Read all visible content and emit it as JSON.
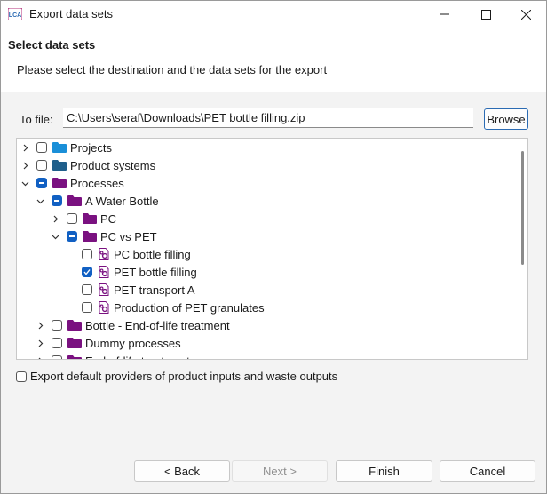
{
  "window": {
    "title": "Export data sets",
    "app_icon": "lca-app-icon"
  },
  "header": {
    "title": "Select data sets",
    "description": "Please select the destination and the data sets for the export"
  },
  "file": {
    "label": "To file:",
    "value": "C:\\Users\\seraf\\Downloads\\PET bottle filling.zip",
    "browse_label": "Browse"
  },
  "tree": [
    {
      "label": "Projects",
      "level": 0,
      "expanded": false,
      "check": "unchecked",
      "icon": "folder",
      "color": "#1a8fd8"
    },
    {
      "label": "Product systems",
      "level": 0,
      "expanded": false,
      "check": "unchecked",
      "icon": "folder",
      "color": "#1f5f8b"
    },
    {
      "label": "Processes",
      "level": 0,
      "expanded": true,
      "check": "partial",
      "icon": "folder",
      "color": "#7a1180"
    },
    {
      "label": "A Water Bottle",
      "level": 1,
      "expanded": true,
      "check": "partial",
      "icon": "folder",
      "color": "#7a1180"
    },
    {
      "label": "PC",
      "level": 2,
      "expanded": false,
      "check": "unchecked",
      "icon": "folder",
      "color": "#7a1180"
    },
    {
      "label": "PC vs PET",
      "level": 2,
      "expanded": true,
      "check": "partial",
      "icon": "folder",
      "color": "#7a1180"
    },
    {
      "label": "PC bottle filling",
      "level": 3,
      "leaf": true,
      "check": "unchecked",
      "icon": "process"
    },
    {
      "label": "PET bottle filling",
      "level": 3,
      "leaf": true,
      "check": "checked",
      "icon": "process"
    },
    {
      "label": "PET transport A",
      "level": 3,
      "leaf": true,
      "check": "unchecked",
      "icon": "process"
    },
    {
      "label": "Production of PET granulates",
      "level": 3,
      "leaf": true,
      "check": "unchecked",
      "icon": "process"
    },
    {
      "label": "Bottle - End-of-life treatment",
      "level": 1,
      "expanded": false,
      "check": "unchecked",
      "icon": "folder",
      "color": "#7a1180"
    },
    {
      "label": "Dummy processes",
      "level": 1,
      "expanded": false,
      "check": "unchecked",
      "icon": "folder",
      "color": "#7a1180"
    },
    {
      "label": "End-of-life treatment",
      "level": 1,
      "expanded": false,
      "check": "unchecked",
      "icon": "folder",
      "color": "#7a1180"
    }
  ],
  "export_option": {
    "label": "Export default providers of product inputs and waste outputs",
    "checked": false
  },
  "buttons": {
    "back": "< Back",
    "next": "Next >",
    "finish": "Finish",
    "cancel": "Cancel"
  },
  "colors": {
    "accent": "#1160c3",
    "process_icon": "#7a1180"
  }
}
